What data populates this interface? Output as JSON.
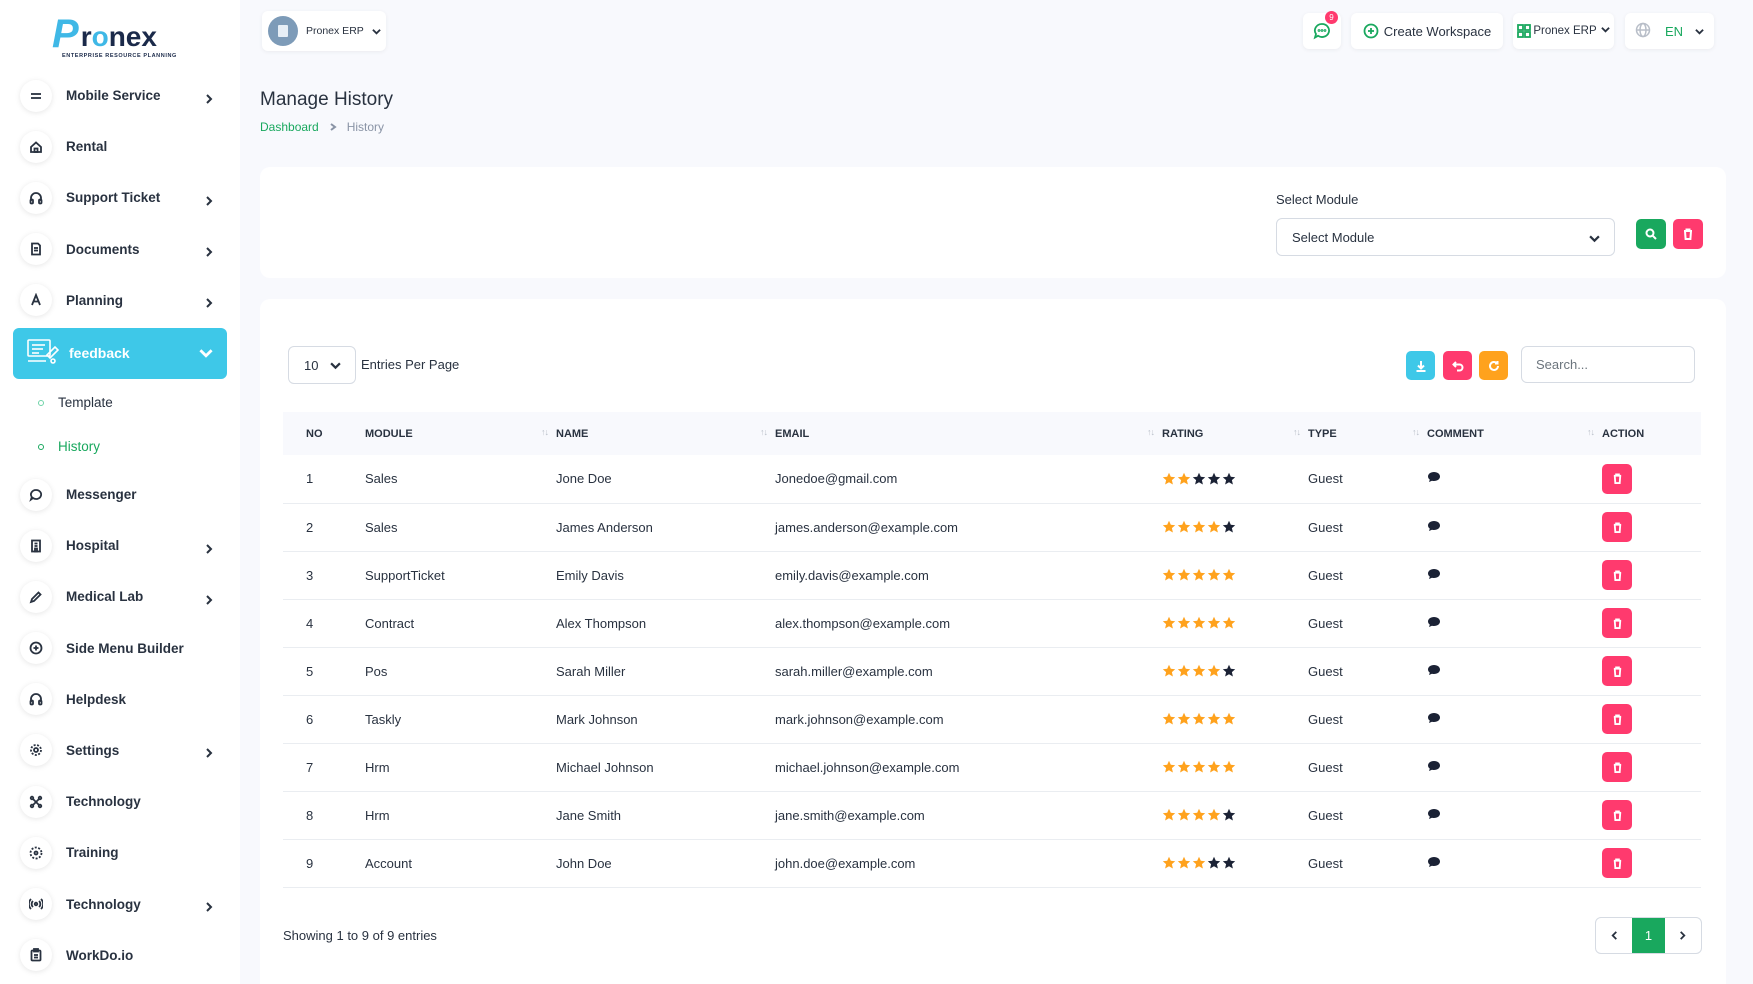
{
  "brand": {
    "logo_letter": "P",
    "logo_text_prefix": "r",
    "logo_text_o": "o",
    "logo_text_suffix": "nex",
    "tagline": "ENTERPRISE RESOURCE PLANNING"
  },
  "sidebar": {
    "items": [
      {
        "label": "Mobile Service",
        "icon": "menu-lines-icon",
        "has_children": true
      },
      {
        "label": "Rental",
        "icon": "home-icon",
        "has_children": false
      },
      {
        "label": "Support Ticket",
        "icon": "headphones-icon",
        "has_children": true
      },
      {
        "label": "Documents",
        "icon": "document-icon",
        "has_children": true
      },
      {
        "label": "Planning",
        "icon": "letter-a-icon",
        "has_children": true
      }
    ],
    "active_item": {
      "label": "feedback",
      "icon": "feedback-board-icon"
    },
    "submenu": [
      {
        "label": "Template"
      },
      {
        "label": "History"
      }
    ],
    "items_after": [
      {
        "label": "Messenger",
        "icon": "chat-icon",
        "has_children": false
      },
      {
        "label": "Hospital",
        "icon": "building-icon",
        "has_children": true
      },
      {
        "label": "Medical Lab",
        "icon": "pen-icon",
        "has_children": true
      },
      {
        "label": "Side Menu Builder",
        "icon": "plus-circle-icon",
        "has_children": false
      },
      {
        "label": "Helpdesk",
        "icon": "headphones-icon",
        "has_children": false
      },
      {
        "label": "Settings",
        "icon": "gear-icon",
        "has_children": true
      },
      {
        "label": "Technology",
        "icon": "network-icon",
        "has_children": false
      },
      {
        "label": "Training",
        "icon": "target-icon",
        "has_children": false
      },
      {
        "label": "Technology",
        "icon": "broadcast-icon",
        "has_children": true
      },
      {
        "label": "WorkDo.io",
        "icon": "clipboard-icon",
        "has_children": false
      }
    ]
  },
  "header": {
    "workspace": "Pronex ERP",
    "notification_count": "9",
    "create_workspace": "Create Workspace",
    "erp_menu": "Pronex ERP",
    "language": "EN"
  },
  "page": {
    "title": "Manage History",
    "breadcrumb": {
      "home": "Dashboard",
      "current": "History"
    }
  },
  "filter": {
    "label": "Select Module",
    "selected": "Select Module"
  },
  "table": {
    "per_page": "10",
    "per_page_label": "Entries Per Page",
    "search_placeholder": "Search...",
    "columns": [
      "NO",
      "MODULE",
      "NAME",
      "EMAIL",
      "RATING",
      "TYPE",
      "COMMENT",
      "ACTION"
    ],
    "rows": [
      {
        "no": "1",
        "module": "Sales",
        "name": "Jone Doe",
        "email": "Jonedoe@gmail.com",
        "rating": 2,
        "type": "Guest"
      },
      {
        "no": "2",
        "module": "Sales",
        "name": "James Anderson",
        "email": "james.anderson@example.com",
        "rating": 4,
        "type": "Guest"
      },
      {
        "no": "3",
        "module": "SupportTicket",
        "name": "Emily Davis",
        "email": "emily.davis@example.com",
        "rating": 5,
        "type": "Guest"
      },
      {
        "no": "4",
        "module": "Contract",
        "name": "Alex Thompson",
        "email": "alex.thompson@example.com",
        "rating": 5,
        "type": "Guest"
      },
      {
        "no": "5",
        "module": "Pos",
        "name": "Sarah Miller",
        "email": "sarah.miller@example.com",
        "rating": 4,
        "type": "Guest"
      },
      {
        "no": "6",
        "module": "Taskly",
        "name": "Mark Johnson",
        "email": "mark.johnson@example.com",
        "rating": 5,
        "type": "Guest"
      },
      {
        "no": "7",
        "module": "Hrm",
        "name": "Michael Johnson",
        "email": "michael.johnson@example.com",
        "rating": 5,
        "type": "Guest"
      },
      {
        "no": "8",
        "module": "Hrm",
        "name": "Jane Smith",
        "email": "jane.smith@example.com",
        "rating": 4,
        "type": "Guest"
      },
      {
        "no": "9",
        "module": "Account",
        "name": "John Doe",
        "email": "john.doe@example.com",
        "rating": 3,
        "type": "Guest"
      }
    ],
    "showing": "Showing 1 to 9 of 9 entries",
    "current_page": "1"
  },
  "colors": {
    "primary_green": "#19a85e",
    "cyan": "#3ec8e8",
    "danger": "#ff3a6e",
    "warning": "#ffa21d",
    "star_filled": "#ffa21d",
    "star_empty": "#1b2235"
  }
}
